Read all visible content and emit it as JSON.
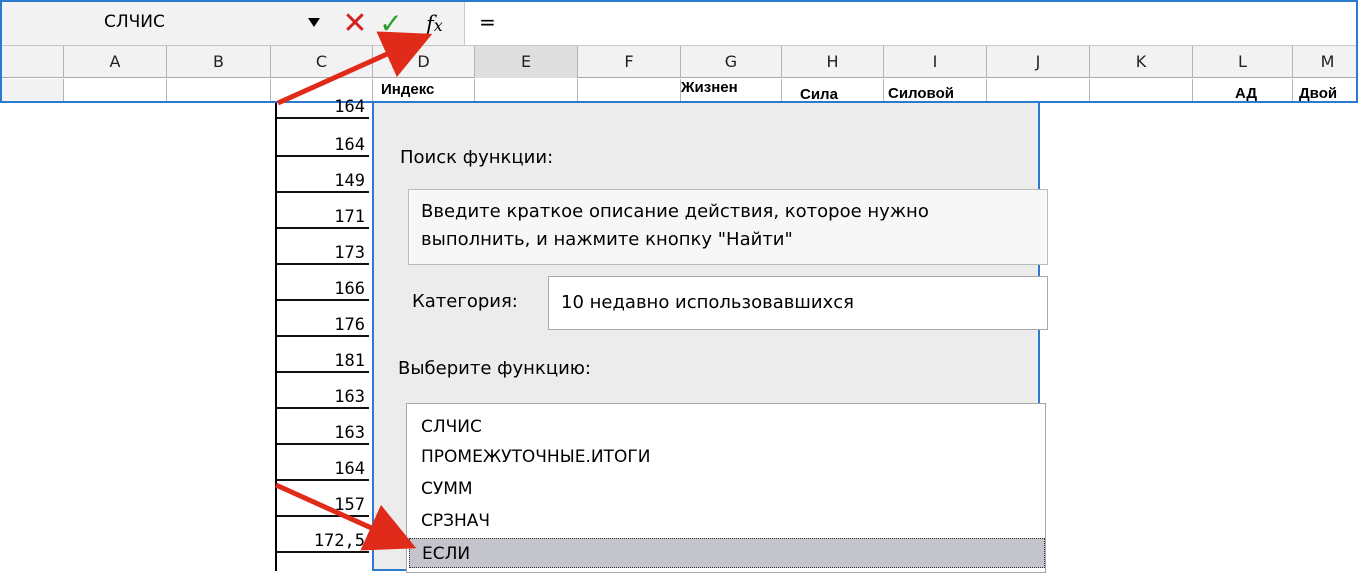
{
  "formula_bar": {
    "name_box": "СЛЧИС",
    "cancel_symbol": "✕",
    "enter_symbol": "✓",
    "fx_f": "f",
    "fx_x": "x",
    "formula": "="
  },
  "columns": [
    "A",
    "B",
    "C",
    "D",
    "E",
    "F",
    "G",
    "H",
    "I",
    "J",
    "K",
    "L",
    "M"
  ],
  "header_row_cells": {
    "D": "Индекс",
    "G": "Жизнен",
    "H": "Сила",
    "I": "Силовой",
    "L": "АД",
    "M": "Двой"
  },
  "column_c_values": [
    "164",
    "164",
    "149",
    "171",
    "173",
    "166",
    "176",
    "181",
    "163",
    "163",
    "164",
    "157",
    "172,5"
  ],
  "dialog": {
    "search_label": "Поиск функции:",
    "search_placeholder_line1": "Введите краткое описание действия, которое нужно",
    "search_placeholder_line2": "выполнить, и нажмите кнопку \"Найти\"",
    "category_label": "Категория:",
    "category_value": "10 недавно использовавшихся",
    "function_label": "Выберите функцию:",
    "functions": [
      "СЛЧИС",
      "ПРОМЕЖУТОЧНЫЕ.ИТОГИ",
      "СУММ",
      "СРЗНАЧ",
      "ЕСЛИ"
    ],
    "selected_function": "ЕСЛИ"
  },
  "colors": {
    "accent_border": "#2b7ad0",
    "cancel": "#d32020",
    "enter": "#2ca02c",
    "arrow": "#e02a1a",
    "selected_row": "#c4c4cc"
  }
}
